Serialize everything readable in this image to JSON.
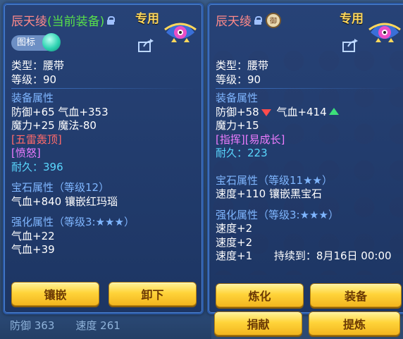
{
  "background": {
    "stat_left": "防御 363",
    "stat_right": "速度 261"
  },
  "left_panel": {
    "name": "辰天绫",
    "equipped": "(当前装备)",
    "tag": "专用",
    "pill_label": "图标",
    "type_line": "类型：腰带",
    "level_line": "等级：90",
    "attr_title": "装备属性",
    "attr1": "防御+65 气血+353",
    "attr2": "魔力+25 魔法-80",
    "special1": "[五雷轰顶]",
    "special2": "[愤怒]",
    "durability": "耐久：396",
    "gem_title": "宝石属性（等级12）",
    "gem_line": "气血+840 镶嵌红玛瑙",
    "enhance_title": "强化属性（等级3:★★★）",
    "enhance1": "气血+22",
    "enhance2": "气血+39",
    "buttons": [
      "镶嵌",
      "卸下"
    ]
  },
  "right_panel": {
    "name": "辰天绫",
    "seal": "御",
    "tag": "专用",
    "type_line": "类型：腰带",
    "level_line": "等级：90",
    "attr_title": "装备属性",
    "attr1a": "防御+58",
    "attr1b": "气血+414",
    "attr2": "魔力+15",
    "special": "[指挥][易成长]",
    "durability": "耐久：223",
    "gem_title": "宝石属性（等级11★★）",
    "gem_line": "速度+110 镶嵌黑宝石",
    "enhance_title": "强化属性（等级3:★★★）",
    "enhance1": "速度+2",
    "enhance2": "速度+2",
    "enhance3": "速度+1",
    "enhance3_until": "持续到：8月16日 00:00",
    "buttons": [
      "炼化",
      "装备",
      "捐献",
      "提炼"
    ]
  },
  "colors": {
    "accent_gold": "#ffd43a",
    "panel_bg": "#1c3462",
    "section_blue": "#7fb6ff"
  },
  "icons": [
    "lock-icon",
    "seal-icon",
    "share-icon",
    "mascot-icon",
    "orb-icon",
    "arrow-down-icon",
    "arrow-up-icon"
  ]
}
